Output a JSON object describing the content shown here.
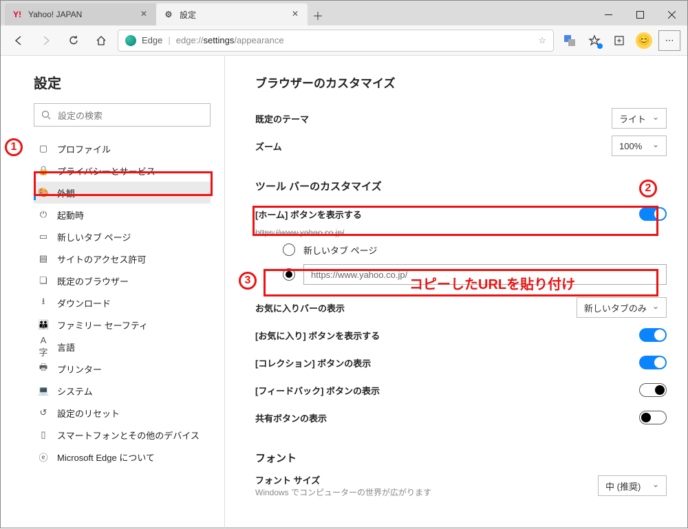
{
  "window": {
    "tabs": [
      {
        "favicon_text": "Y!",
        "favicon_color": "#e3002d",
        "title": "Yahoo! JAPAN",
        "active": false
      },
      {
        "favicon_text": "⚙",
        "favicon_color": "#555",
        "title": "設定",
        "active": true
      }
    ]
  },
  "toolbar": {
    "edge_label": "Edge",
    "url_display": "edge://settings/appearance",
    "url_bold_part": "settings"
  },
  "sidebar": {
    "title": "設定",
    "search_placeholder": "設定の検索",
    "items": [
      {
        "icon": "👤",
        "label": "プロファイル"
      },
      {
        "icon": "🔒",
        "label": "プライバシーとサービス"
      },
      {
        "icon": "🎨",
        "label": "外観",
        "active": true
      },
      {
        "icon": "⏻",
        "label": "起動時"
      },
      {
        "icon": "▭",
        "label": "新しいタブ ページ"
      },
      {
        "icon": "▤",
        "label": "サイトのアクセス許可"
      },
      {
        "icon": "❏",
        "label": "既定のブラウザー"
      },
      {
        "icon": "⭳",
        "label": "ダウンロード"
      },
      {
        "icon": "👪",
        "label": "ファミリー セーフティ"
      },
      {
        "icon": "�霊",
        "label": "言語"
      },
      {
        "icon": "🖶",
        "label": "プリンター"
      },
      {
        "icon": "💻",
        "label": "システム"
      },
      {
        "icon": "↺",
        "label": "設定のリセット"
      },
      {
        "icon": "📱",
        "label": "スマートフォンとその他のデバイス"
      },
      {
        "icon": "ⓔ",
        "label": "Microsoft Edge について"
      }
    ]
  },
  "appearance": {
    "section1_title": "ブラウザーのカスタマイズ",
    "theme_label": "既定のテーマ",
    "theme_value": "ライト",
    "zoom_label": "ズーム",
    "zoom_value": "100%",
    "section2_title": "ツール バーのカスタマイズ",
    "home_btn_label": "[ホーム] ボタンを表示する",
    "home_btn_url_hint": "https://www.yahoo.co.jp/",
    "radio_newtab": "新しいタブ ページ",
    "radio_url_value": "https://www.yahoo.co.jp/",
    "favbar_label": "お気に入りバーの表示",
    "favbar_value": "新しいタブのみ",
    "fav_btn_label": "[お気に入り] ボタンを表示する",
    "coll_btn_label": "[コレクション] ボタンの表示",
    "feedback_btn_label": "[フィードバック] ボタンの表示",
    "share_btn_label": "共有ボタンの表示",
    "section3_title": "フォント",
    "fontsize_label": "フォント サイズ",
    "fontsize_value": "中 (推奨)",
    "fontsize_hint": "Windows でコンピューターの世界が広がります"
  },
  "annotations": {
    "badge1": "1",
    "badge2": "2",
    "badge3": "3",
    "text3": "コピーしたURLを貼り付け"
  }
}
